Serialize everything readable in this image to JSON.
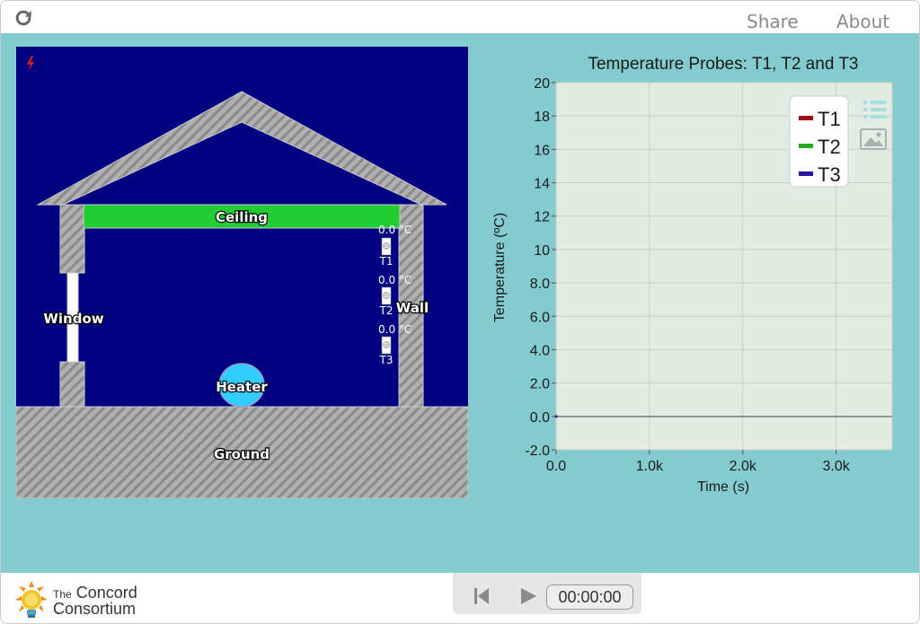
{
  "topbar": {
    "share_label": "Share",
    "about_label": "About",
    "reload_icon": "reload-icon"
  },
  "simulation": {
    "labels": {
      "ceiling": "Ceiling",
      "window": "Window",
      "wall": "Wall",
      "heater": "Heater",
      "ground": "Ground"
    },
    "probes": [
      {
        "name": "T1",
        "reading": "0.0 °C"
      },
      {
        "name": "T2",
        "reading": "0.0 °C"
      },
      {
        "name": "T3",
        "reading": "0.0 °C"
      }
    ],
    "colors": {
      "background": "#000080",
      "ceiling": "#22cc33",
      "heater": "#33ccff",
      "hatch_base": "#a8a8a8"
    }
  },
  "chart_data": {
    "type": "line",
    "title": "Temperature Probes: T1, T2 and T3",
    "xlabel": "Time (s)",
    "ylabel": "Temperature (ºC)",
    "xlim": [
      0,
      3600
    ],
    "ylim": [
      -2,
      20
    ],
    "x_ticks": [
      "0.0",
      "1.0k",
      "2.0k",
      "3.0k"
    ],
    "y_ticks": [
      "-2.0",
      "0.0",
      "2.0",
      "4.0",
      "6.0",
      "8.0",
      "10",
      "12",
      "14",
      "16",
      "18",
      "20"
    ],
    "grid": true,
    "legend_position": "top-right",
    "series": [
      {
        "name": "T1",
        "color": "#a01010",
        "x": [
          0
        ],
        "y": [
          0
        ]
      },
      {
        "name": "T2",
        "color": "#22aa22",
        "x": [
          0
        ],
        "y": [
          0
        ]
      },
      {
        "name": "T3",
        "color": "#2a16a0",
        "x": [
          0
        ],
        "y": [
          0
        ]
      }
    ]
  },
  "footer": {
    "logo_small": "The",
    "logo_line1": "Concord",
    "logo_line2": "Consortium",
    "time": "00:00:00"
  }
}
